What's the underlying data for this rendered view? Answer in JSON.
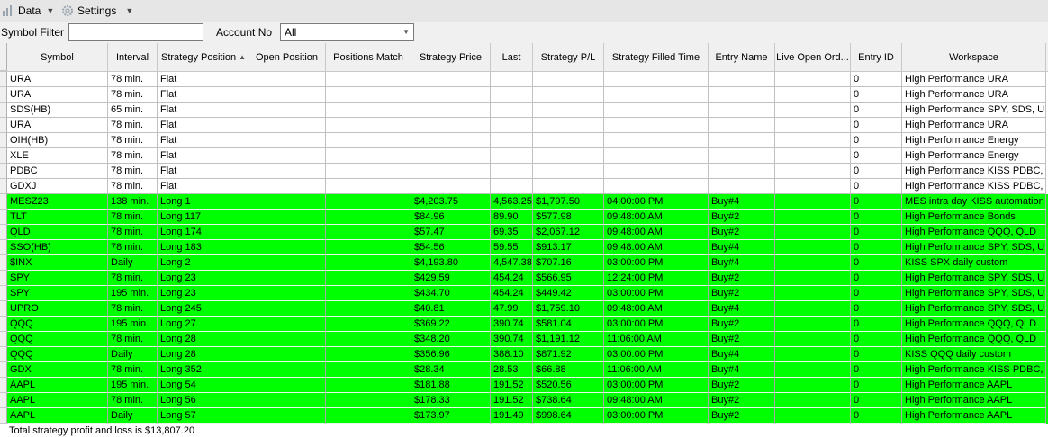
{
  "toolbar": {
    "data_label": "Data",
    "settings_label": "Settings"
  },
  "filters": {
    "symbol_filter_label": "Symbol Filter",
    "symbol_filter_value": "",
    "account_label": "Account No",
    "account_value": "All"
  },
  "columns": [
    "Symbol",
    "Interval",
    "Strategy Position",
    "Open Position",
    "Positions Match",
    "Strategy Price",
    "Last",
    "Strategy P/L",
    "Strategy Filled Time",
    "Entry Name",
    "Live Open Ord...",
    "Entry ID",
    "Workspace"
  ],
  "sorted_column": "Strategy Position",
  "rows": [
    {
      "status": "flat",
      "symbol": "URA",
      "interval": "78 min.",
      "position": "Flat",
      "open_pos": "",
      "match": "",
      "price": "",
      "last": "",
      "pl": "",
      "filled": "",
      "entry": "",
      "live": "",
      "entry_id": "0",
      "workspace": "High Performance URA"
    },
    {
      "status": "flat",
      "symbol": "URA",
      "interval": "78 min.",
      "position": "Flat",
      "open_pos": "",
      "match": "",
      "price": "",
      "last": "",
      "pl": "",
      "filled": "",
      "entry": "",
      "live": "",
      "entry_id": "0",
      "workspace": "High Performance URA"
    },
    {
      "status": "flat",
      "symbol": "SDS(HB)",
      "interval": "65 min.",
      "position": "Flat",
      "open_pos": "",
      "match": "",
      "price": "",
      "last": "",
      "pl": "",
      "filled": "",
      "entry": "",
      "live": "",
      "entry_id": "0",
      "workspace": "High Performance SPY, SDS, U"
    },
    {
      "status": "flat",
      "symbol": "URA",
      "interval": "78 min.",
      "position": "Flat",
      "open_pos": "",
      "match": "",
      "price": "",
      "last": "",
      "pl": "",
      "filled": "",
      "entry": "",
      "live": "",
      "entry_id": "0",
      "workspace": "High Performance URA"
    },
    {
      "status": "flat",
      "symbol": "OIH(HB)",
      "interval": "78 min.",
      "position": "Flat",
      "open_pos": "",
      "match": "",
      "price": "",
      "last": "",
      "pl": "",
      "filled": "",
      "entry": "",
      "live": "",
      "entry_id": "0",
      "workspace": "High Performance Energy"
    },
    {
      "status": "flat",
      "symbol": "XLE",
      "interval": "78 min.",
      "position": "Flat",
      "open_pos": "",
      "match": "",
      "price": "",
      "last": "",
      "pl": "",
      "filled": "",
      "entry": "",
      "live": "",
      "entry_id": "0",
      "workspace": "High Performance Energy"
    },
    {
      "status": "flat",
      "symbol": "PDBC",
      "interval": "78 min.",
      "position": "Flat",
      "open_pos": "",
      "match": "",
      "price": "",
      "last": "",
      "pl": "",
      "filled": "",
      "entry": "",
      "live": "",
      "entry_id": "0",
      "workspace": "High Performance KISS PDBC, G"
    },
    {
      "status": "flat",
      "symbol": "GDXJ",
      "interval": "78 min.",
      "position": "Flat",
      "open_pos": "",
      "match": "",
      "price": "",
      "last": "",
      "pl": "",
      "filled": "",
      "entry": "",
      "live": "",
      "entry_id": "0",
      "workspace": "High Performance KISS PDBC, G"
    },
    {
      "status": "long",
      "symbol": "MESZ23",
      "interval": "138 min.",
      "position": "Long 1",
      "open_pos": "",
      "match": "",
      "price": "$4,203.75",
      "last": "4,563.25",
      "pl": "$1,797.50",
      "filled": "04:00:00 PM",
      "entry": "Buy#4",
      "live": "",
      "entry_id": "0",
      "workspace": "MES intra day KISS automation"
    },
    {
      "status": "long",
      "symbol": "TLT",
      "interval": "78 min.",
      "position": "Long 117",
      "open_pos": "",
      "match": "",
      "price": "$84.96",
      "last": "89.90",
      "pl": "$577.98",
      "filled": "09:48:00 AM",
      "entry": "Buy#2",
      "live": "",
      "entry_id": "0",
      "workspace": "High Performance Bonds"
    },
    {
      "status": "long",
      "symbol": "QLD",
      "interval": "78 min.",
      "position": "Long 174",
      "open_pos": "",
      "match": "",
      "price": "$57.47",
      "last": "69.35",
      "pl": "$2,067.12",
      "filled": "09:48:00 AM",
      "entry": "Buy#2",
      "live": "",
      "entry_id": "0",
      "workspace": "High Performance QQQ, QLD"
    },
    {
      "status": "long",
      "symbol": "SSO(HB)",
      "interval": "78 min.",
      "position": "Long 183",
      "open_pos": "",
      "match": "",
      "price": "$54.56",
      "last": "59.55",
      "pl": "$913.17",
      "filled": "09:48:00 AM",
      "entry": "Buy#4",
      "live": "",
      "entry_id": "0",
      "workspace": "High Performance SPY, SDS, U"
    },
    {
      "status": "long",
      "symbol": "$INX",
      "interval": "Daily",
      "position": "Long 2",
      "open_pos": "",
      "match": "",
      "price": "$4,193.80",
      "last": "4,547.38",
      "pl": "$707.16",
      "filled": "03:00:00 PM",
      "entry": "Buy#4",
      "live": "",
      "entry_id": "0",
      "workspace": "KISS SPX daily custom"
    },
    {
      "status": "long",
      "symbol": "SPY",
      "interval": "78 min.",
      "position": "Long 23",
      "open_pos": "",
      "match": "",
      "price": "$429.59",
      "last": "454.24",
      "pl": "$566.95",
      "filled": "12:24:00 PM",
      "entry": "Buy#2",
      "live": "",
      "entry_id": "0",
      "workspace": "High Performance SPY, SDS, U"
    },
    {
      "status": "long",
      "symbol": "SPY",
      "interval": "195 min.",
      "position": "Long 23",
      "open_pos": "",
      "match": "",
      "price": "$434.70",
      "last": "454.24",
      "pl": "$449.42",
      "filled": "03:00:00 PM",
      "entry": "Buy#2",
      "live": "",
      "entry_id": "0",
      "workspace": "High Performance SPY, SDS, U"
    },
    {
      "status": "long",
      "symbol": "UPRO",
      "interval": "78 min.",
      "position": "Long 245",
      "open_pos": "",
      "match": "",
      "price": "$40.81",
      "last": "47.99",
      "pl": "$1,759.10",
      "filled": "09:48:00 AM",
      "entry": "Buy#4",
      "live": "",
      "entry_id": "0",
      "workspace": "High Performance SPY, SDS, U"
    },
    {
      "status": "long",
      "symbol": "QQQ",
      "interval": "195 min.",
      "position": "Long 27",
      "open_pos": "",
      "match": "",
      "price": "$369.22",
      "last": "390.74",
      "pl": "$581.04",
      "filled": "03:00:00 PM",
      "entry": "Buy#2",
      "live": "",
      "entry_id": "0",
      "workspace": "High Performance QQQ, QLD"
    },
    {
      "status": "long",
      "symbol": "QQQ",
      "interval": "78 min.",
      "position": "Long 28",
      "open_pos": "",
      "match": "",
      "price": "$348.20",
      "last": "390.74",
      "pl": "$1,191.12",
      "filled": "11:06:00 AM",
      "entry": "Buy#2",
      "live": "",
      "entry_id": "0",
      "workspace": "High Performance QQQ, QLD"
    },
    {
      "status": "long",
      "symbol": "QQQ",
      "interval": "Daily",
      "position": "Long 28",
      "open_pos": "",
      "match": "",
      "price": "$356.96",
      "last": "388.10",
      "pl": "$871.92",
      "filled": "03:00:00 PM",
      "entry": "Buy#4",
      "live": "",
      "entry_id": "0",
      "workspace": "KISS QQQ daily custom"
    },
    {
      "status": "long",
      "symbol": "GDX",
      "interval": "78 min.",
      "position": "Long 352",
      "open_pos": "",
      "match": "",
      "price": "$28.34",
      "last": "28.53",
      "pl": "$66.88",
      "filled": "11:06:00 AM",
      "entry": "Buy#4",
      "live": "",
      "entry_id": "0",
      "workspace": "High Performance KISS PDBC, G"
    },
    {
      "status": "long",
      "symbol": "AAPL",
      "interval": "195 min.",
      "position": "Long 54",
      "open_pos": "",
      "match": "",
      "price": "$181.88",
      "last": "191.52",
      "pl": "$520.56",
      "filled": "03:00:00 PM",
      "entry": "Buy#2",
      "live": "",
      "entry_id": "0",
      "workspace": "High Performance AAPL"
    },
    {
      "status": "long",
      "symbol": "AAPL",
      "interval": "78 min.",
      "position": "Long 56",
      "open_pos": "",
      "match": "",
      "price": "$178.33",
      "last": "191.52",
      "pl": "$738.64",
      "filled": "09:48:00 AM",
      "entry": "Buy#2",
      "live": "",
      "entry_id": "0",
      "workspace": "High Performance AAPL"
    },
    {
      "status": "long",
      "symbol": "AAPL",
      "interval": "Daily",
      "position": "Long 57",
      "open_pos": "",
      "match": "",
      "price": "$173.97",
      "last": "191.49",
      "pl": "$998.64",
      "filled": "03:00:00 PM",
      "entry": "Buy#2",
      "live": "",
      "entry_id": "0",
      "workspace": "High Performance AAPL"
    }
  ],
  "footer": {
    "total_text": "Total strategy profit and loss is $13,807.20"
  },
  "colors": {
    "long_row": "#00ff00",
    "flat_row": "#ffffff"
  }
}
